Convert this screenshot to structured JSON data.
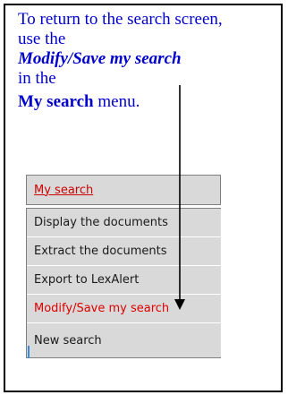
{
  "instructions": {
    "line1": "To return to the search screen,",
    "line2": "use the",
    "line3": "Modify/Save my search",
    "line4": " in the",
    "line5_bold": "My search",
    "line5_rest": " menu."
  },
  "menu": {
    "header": "My search",
    "items": [
      {
        "label": "Display the documents"
      },
      {
        "label": "Extract the documents"
      },
      {
        "label": "Export to LexAlert"
      },
      {
        "label": "Modify/Save my search"
      },
      {
        "label": "New search"
      }
    ]
  },
  "colors": {
    "instruction_text": "#0000cc",
    "menu_active": "#dd0000",
    "menu_bg": "#d9d9d9"
  }
}
